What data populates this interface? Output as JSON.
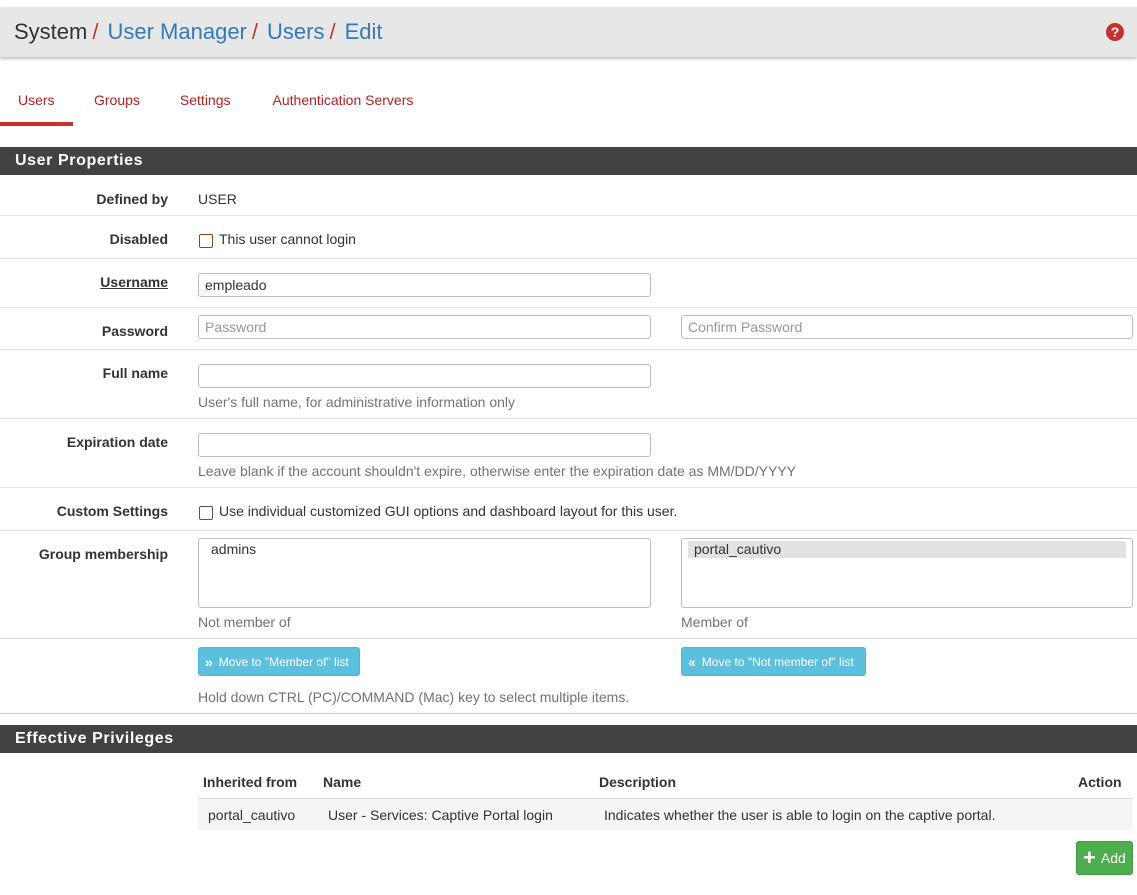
{
  "breadcrumb": {
    "items": [
      "System",
      "User Manager",
      "Users",
      "Edit"
    ],
    "separator": "/"
  },
  "help_icon": "question-circle-icon",
  "tabs": [
    {
      "label": "Users",
      "active": true
    },
    {
      "label": "Groups",
      "active": false
    },
    {
      "label": "Settings",
      "active": false
    },
    {
      "label": "Authentication Servers",
      "active": false
    }
  ],
  "user_properties": {
    "heading": "User Properties",
    "defined_by": {
      "label": "Defined by",
      "value": "USER"
    },
    "disabled": {
      "label": "Disabled",
      "checkbox_label": "This user cannot login",
      "checked": false
    },
    "username": {
      "label": "Username",
      "value": "empleado"
    },
    "password": {
      "label": "Password",
      "placeholder": "Password",
      "confirm_placeholder": "Confirm Password"
    },
    "full_name": {
      "label": "Full name",
      "value": "",
      "help": "User's full name, for administrative information only"
    },
    "expiration": {
      "label": "Expiration date",
      "value": "",
      "help": "Leave blank if the account shouldn't expire, otherwise enter the expiration date as MM/DD/YYYY"
    },
    "custom_settings": {
      "label": "Custom Settings",
      "checkbox_label": "Use individual customized GUI options and dashboard layout for this user.",
      "checked": false
    },
    "group_membership": {
      "label": "Group membership",
      "not_member_of": [
        "admins"
      ],
      "member_of": [
        "portal_cautivo"
      ],
      "not_member_caption": "Not member of",
      "member_caption": "Member of",
      "move_to_member_label": "Move to \"Member of\" list",
      "move_to_not_member_label": "Move to \"Not member of\" list",
      "multi_select_help": "Hold down CTRL (PC)/COMMAND (Mac) key to select multiple items."
    }
  },
  "effective_privileges": {
    "heading": "Effective Privileges",
    "columns": [
      "Inherited from",
      "Name",
      "Description",
      "Action"
    ],
    "rows": [
      {
        "inherited_from": "portal_cautivo",
        "name": "User - Services: Captive Portal login",
        "description": "Indicates whether the user is able to login on the captive portal.",
        "action": ""
      }
    ],
    "add_label": "Add"
  },
  "colors": {
    "accent_red": "#c9302c",
    "link_blue": "#337ab7",
    "panel_dark": "#424242",
    "btn_info": "#5bc0de",
    "btn_success": "#4cae4c"
  }
}
